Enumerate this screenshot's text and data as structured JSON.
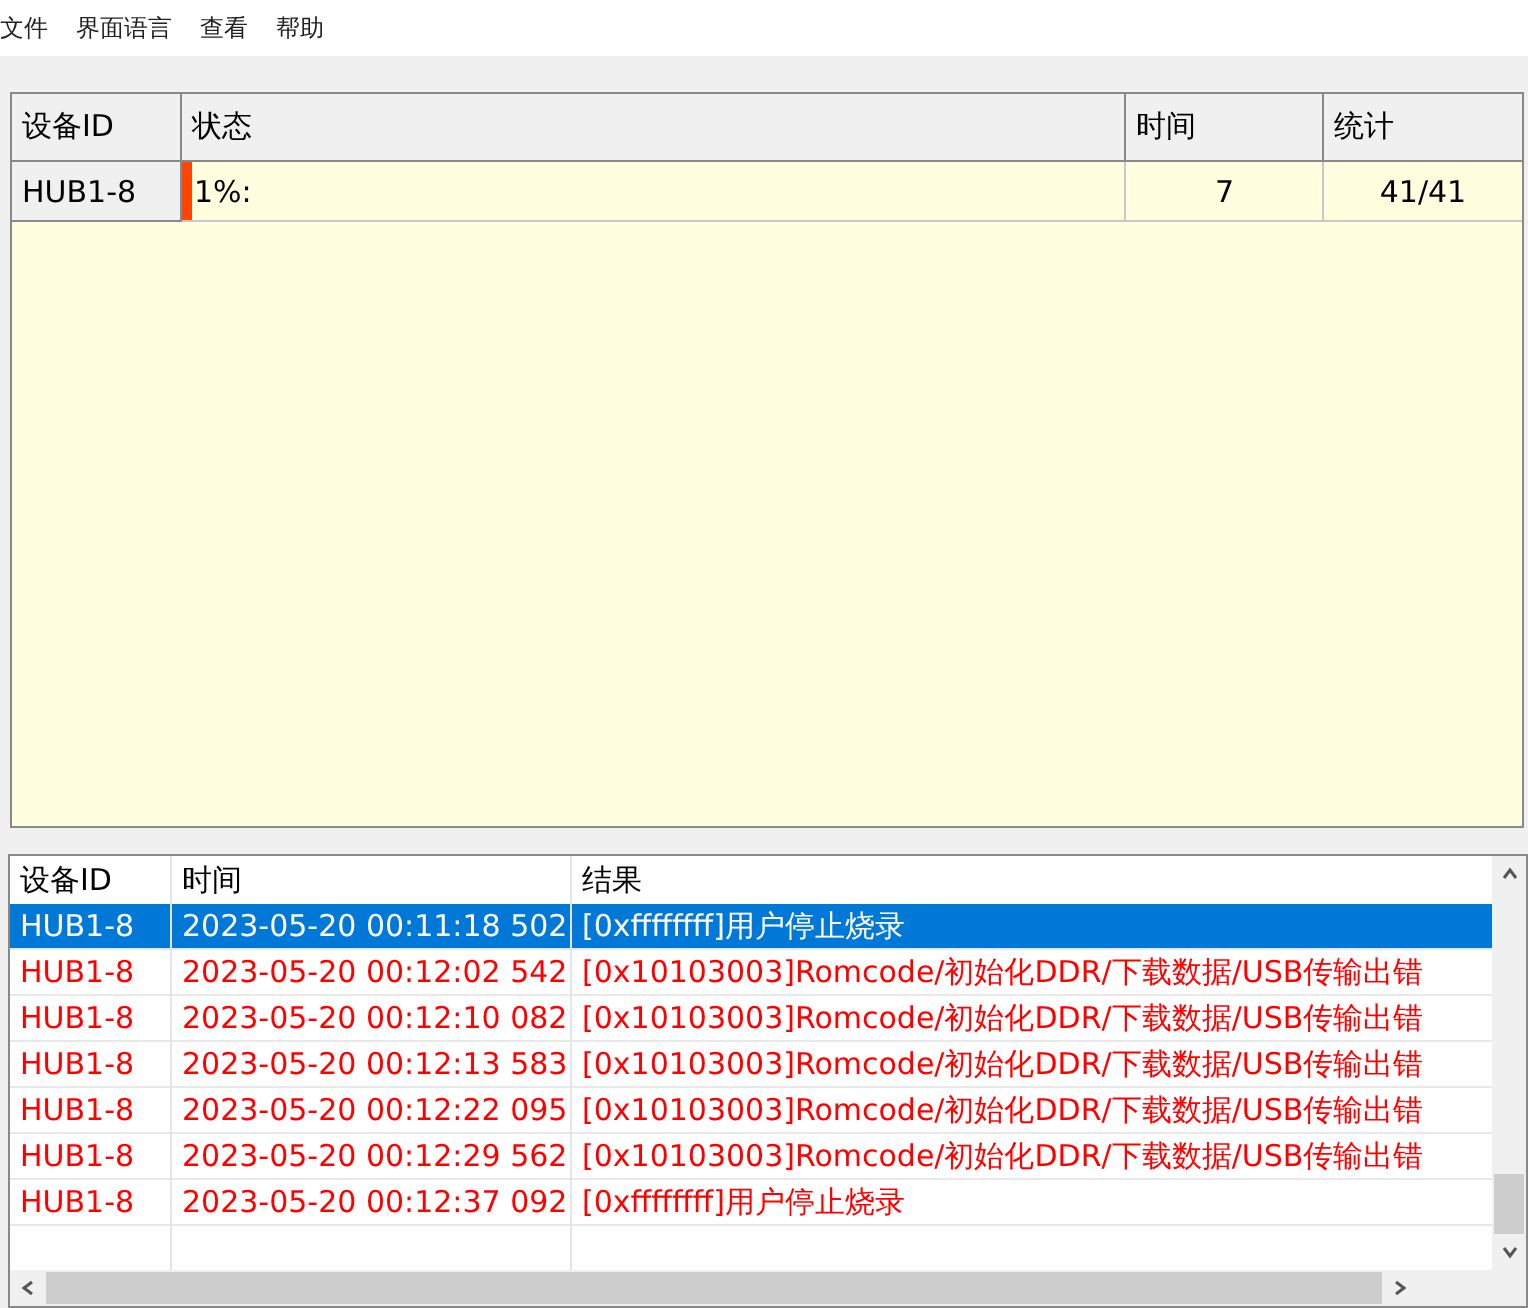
{
  "menu": [
    {
      "label": "文件"
    },
    {
      "label": "界面语言"
    },
    {
      "label": "查看"
    },
    {
      "label": "帮助"
    }
  ],
  "device_table": {
    "columns": [
      "设备ID",
      "状态",
      "时间",
      "统计"
    ],
    "rows": [
      {
        "device_id": "HUB1-8",
        "progress": {
          "level": 0.01,
          "text": "1%:"
        },
        "time": "7",
        "count": "41/41"
      }
    ]
  },
  "log_table": {
    "columns": [
      "设备ID",
      "时间",
      "结果"
    ],
    "rows": [
      {
        "device_id": "HUB1-8",
        "time": "2023-05-20 00:11:18 502",
        "result": "[0xffffffff]用户停止烧录",
        "selected": true
      },
      {
        "device_id": "HUB1-8",
        "time": "2023-05-20 00:12:02 542",
        "result": "[0x10103003]Romcode/初始化DDR/下载数据/USB传输出错",
        "selected": false
      },
      {
        "device_id": "HUB1-8",
        "time": "2023-05-20 00:12:10 082",
        "result": "[0x10103003]Romcode/初始化DDR/下载数据/USB传输出错",
        "selected": false
      },
      {
        "device_id": "HUB1-8",
        "time": "2023-05-20 00:12:13 583",
        "result": "[0x10103003]Romcode/初始化DDR/下载数据/USB传输出错",
        "selected": false
      },
      {
        "device_id": "HUB1-8",
        "time": "2023-05-20 00:12:22 095",
        "result": "[0x10103003]Romcode/初始化DDR/下载数据/USB传输出错",
        "selected": false
      },
      {
        "device_id": "HUB1-8",
        "time": "2023-05-20 00:12:29 562",
        "result": "[0x10103003]Romcode/初始化DDR/下载数据/USB传输出错",
        "selected": false
      },
      {
        "device_id": "HUB1-8",
        "time": "2023-05-20 00:12:37 092",
        "result": "[0xffffffff]用户停止烧录",
        "selected": false
      }
    ]
  }
}
